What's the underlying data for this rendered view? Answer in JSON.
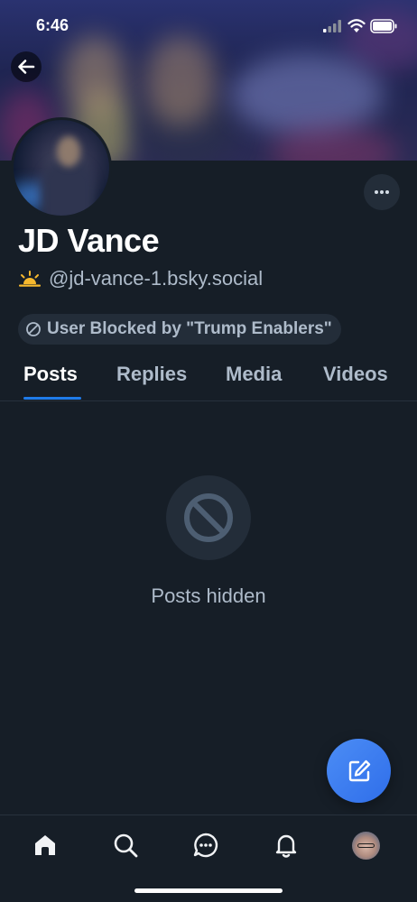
{
  "status_bar": {
    "time": "6:46"
  },
  "profile": {
    "display_name": "JD Vance",
    "handle": "@jd-vance-1.bsky.social",
    "blocked_label": "User Blocked by \"Trump Enablers\""
  },
  "tabs": [
    {
      "label": "Posts",
      "active": true
    },
    {
      "label": "Replies",
      "active": false
    },
    {
      "label": "Media",
      "active": false
    },
    {
      "label": "Videos",
      "active": false
    }
  ],
  "empty_state": {
    "message": "Posts hidden",
    "icon": "block-icon"
  },
  "bottom_nav": {
    "items": [
      {
        "icon": "home-icon"
      },
      {
        "icon": "search-icon"
      },
      {
        "icon": "chat-icon"
      },
      {
        "icon": "bell-icon"
      },
      {
        "icon": "profile-avatar"
      }
    ]
  },
  "colors": {
    "background": "#161e27",
    "surface": "#232d39",
    "accent": "#1f7bea",
    "muted_text": "#aebbca",
    "fab": "#3b7cf0",
    "sun": "#f5b82e"
  }
}
